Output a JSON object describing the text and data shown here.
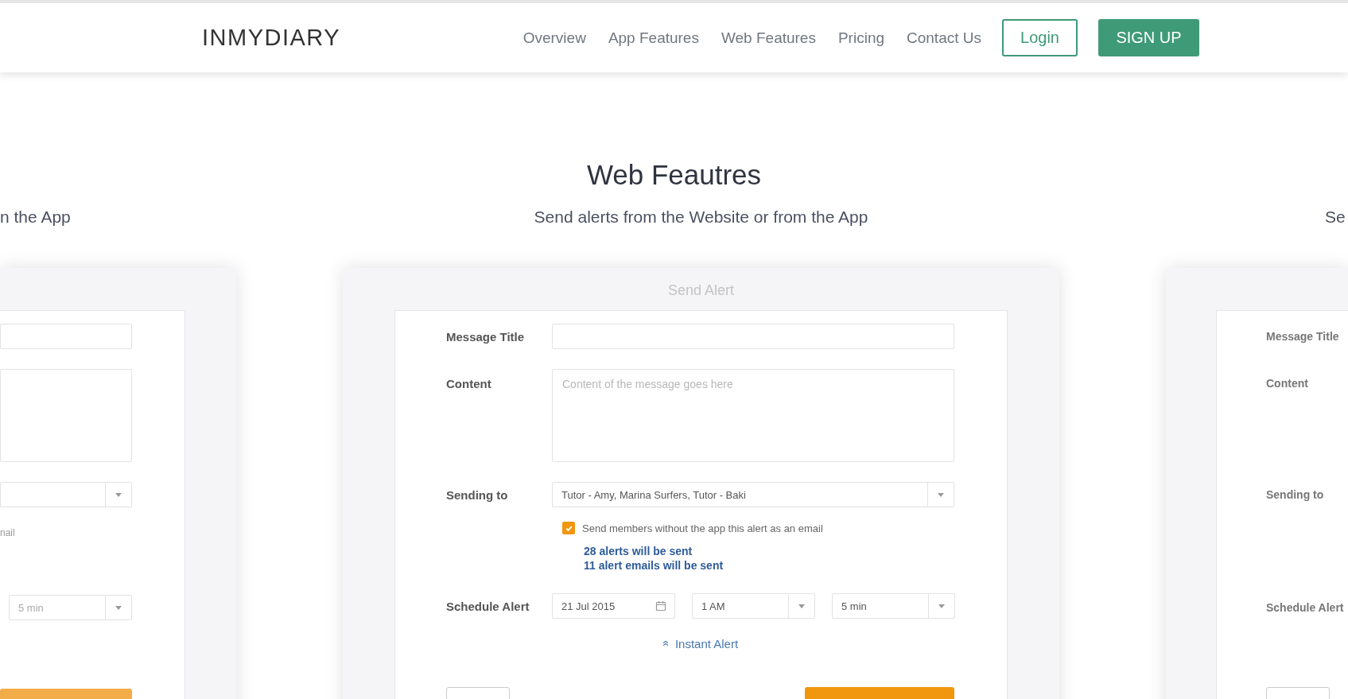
{
  "header": {
    "logo": "INMYDIARY",
    "nav": [
      {
        "label": "Overview"
      },
      {
        "label": "App Features"
      },
      {
        "label": "Web Features"
      },
      {
        "label": "Pricing"
      },
      {
        "label": "Contact Us"
      }
    ],
    "login": "Login",
    "signup": "SIGN UP"
  },
  "heading": "Web Feautres",
  "slides": [
    {
      "kind": "peek-left",
      "subtitle": "n the App",
      "email_note": "nail",
      "minutes": "5 min"
    },
    {
      "kind": "main",
      "subtitle": "Send alerts from the Website or from the App",
      "panel_title": "Send Alert",
      "message_title": {
        "label": "Message Title"
      },
      "content": {
        "label": "Content",
        "placeholder": "Content of the message goes here"
      },
      "sending_to": {
        "label": "Sending to",
        "value": "Tutor - Amy, Marina Surfers, Tutor - Baki"
      },
      "email_option": {
        "label": "Send members without the app this alert as an email",
        "checked": true
      },
      "summary": [
        "28 alerts will be sent",
        "11 alert emails will be sent"
      ],
      "schedule": {
        "label": "Schedule Alert",
        "date": "21 Jul 2015",
        "hour": "1 AM",
        "minutes": "5 min"
      },
      "instant_alert": "Instant Alert"
    },
    {
      "kind": "peek-right",
      "subtitle": "Se",
      "labels": [
        "Message Title",
        "Content",
        "Sending to",
        "Schedule Alert"
      ]
    }
  ]
}
